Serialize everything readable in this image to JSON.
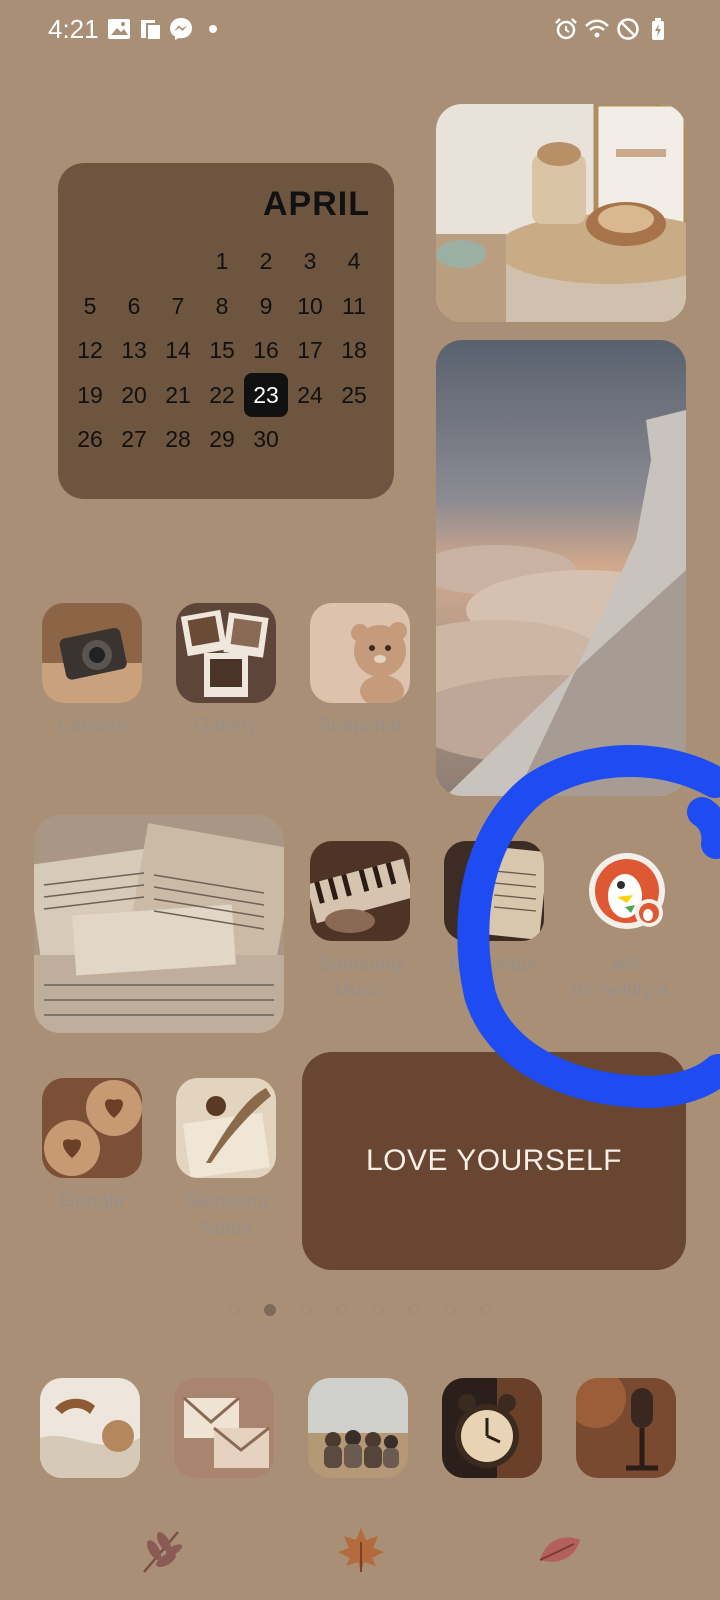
{
  "status_bar": {
    "time": "4:21",
    "left_icons": [
      "gallery-icon",
      "files-icon",
      "messenger-icon",
      "notification-dot-icon"
    ],
    "right_icons": [
      "alarm-icon",
      "wifi-icon",
      "do-not-disturb-icon",
      "battery-charging-icon"
    ]
  },
  "calendar": {
    "month": "APRIL",
    "days": [
      "1",
      "2",
      "3",
      "4",
      "5",
      "6",
      "7",
      "8",
      "9",
      "10",
      "11",
      "12",
      "13",
      "14",
      "15",
      "16",
      "17",
      "18",
      "19",
      "20",
      "21",
      "22",
      "23",
      "24",
      "25",
      "26",
      "27",
      "28",
      "29",
      "30"
    ],
    "today": "23"
  },
  "apps": {
    "camera": "Camera",
    "gallery": "Gallery",
    "snapchat": "Snapchat",
    "samsung_music_line1": "Samsung",
    "samsung_music_line2": "Music",
    "calculator": "Calculator",
    "shortcut_line1": "w8-",
    "shortcut_line2": "d2.netlify.a...",
    "google": "Google",
    "samsung_notes_line1": "Samsung",
    "samsung_notes_line2": "Notes"
  },
  "love_widget": {
    "text": "LOVE YOURSELF"
  },
  "page_indicator": {
    "total": 8,
    "active": 2
  },
  "dock": [
    "phone-icon",
    "messages-icon",
    "friends-photo-icon",
    "clock-icon",
    "microphone-icon"
  ],
  "bottom_icons": [
    "leaf-icon",
    "maple-leaf-icon",
    "autumn-leaf-icon"
  ],
  "colors": {
    "background": "#a88f76",
    "calendar_bg": "#6e5540",
    "love_widget_bg": "#684631",
    "annotation": "#1f4bf2"
  }
}
